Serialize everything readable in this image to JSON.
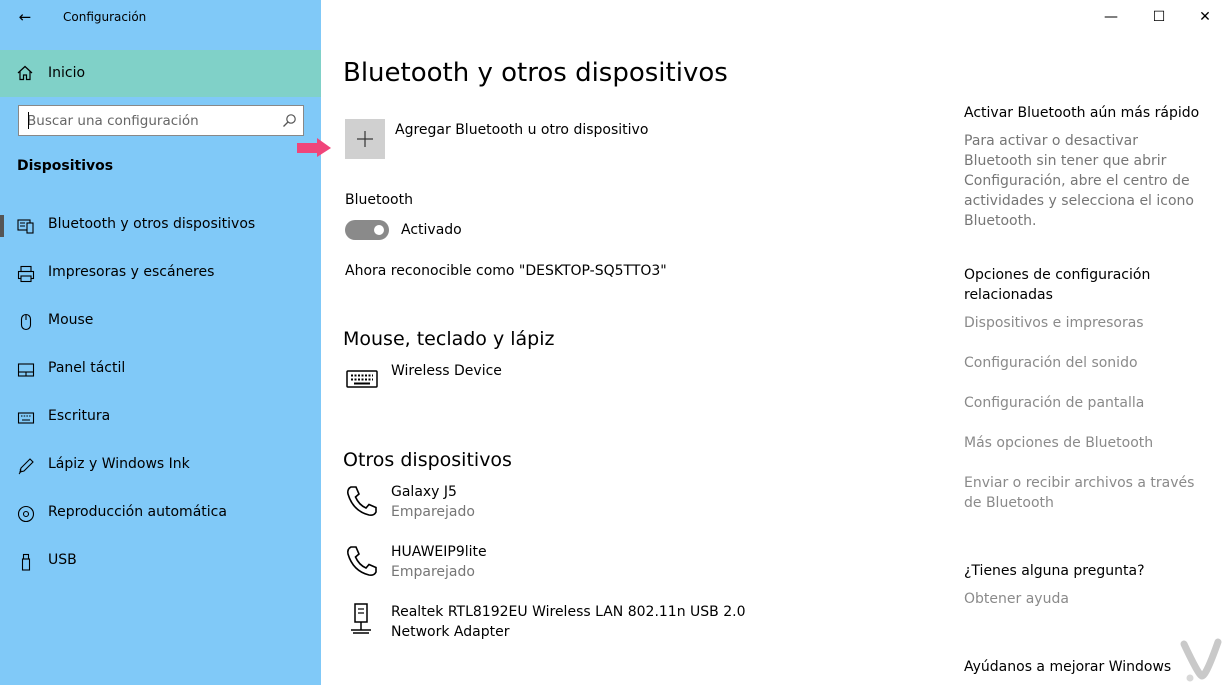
{
  "window": {
    "title": "Configuración",
    "minimize_glyph": "—",
    "maximize_glyph": "☐",
    "close_glyph": "✕"
  },
  "sidebar": {
    "back_glyph": "←",
    "home_label": "Inicio",
    "search_placeholder": "Buscar una configuración",
    "section_title": "Dispositivos",
    "items": [
      {
        "label": "Bluetooth y otros dispositivos",
        "icon": "bluetooth-devices-icon",
        "selected": true
      },
      {
        "label": "Impresoras y escáneres",
        "icon": "printer-icon",
        "selected": false
      },
      {
        "label": "Mouse",
        "icon": "mouse-icon",
        "selected": false
      },
      {
        "label": "Panel táctil",
        "icon": "touchpad-icon",
        "selected": false
      },
      {
        "label": "Escritura",
        "icon": "keyboard-icon",
        "selected": false
      },
      {
        "label": "Lápiz y Windows Ink",
        "icon": "pen-icon",
        "selected": false
      },
      {
        "label": "Reproducción automática",
        "icon": "autoplay-icon",
        "selected": false
      },
      {
        "label": "USB",
        "icon": "usb-icon",
        "selected": false
      }
    ]
  },
  "main": {
    "title": "Bluetooth y otros dispositivos",
    "add_device_label": "Agregar Bluetooth u otro dispositivo",
    "bluetooth_label": "Bluetooth",
    "bluetooth_state": "Activado",
    "discoverable_text": "Ahora reconocible como \"DESKTOP-SQ5TTO3\"",
    "mouse_section": {
      "title": "Mouse, teclado y lápiz",
      "devices": [
        {
          "name": "Wireless Device",
          "status": "",
          "icon": "keyboard-device-icon"
        }
      ]
    },
    "other_section": {
      "title": "Otros dispositivos",
      "devices": [
        {
          "name": "Galaxy J5",
          "status": "Emparejado",
          "icon": "phone-icon"
        },
        {
          "name": "HUAWEIP9lite",
          "status": "Emparejado",
          "icon": "phone-icon"
        },
        {
          "name": "Realtek RTL8192EU Wireless LAN 802.11n USB 2.0",
          "status": "Network Adapter",
          "icon": "network-adapter-icon"
        }
      ]
    }
  },
  "right": {
    "quick_title": "Activar Bluetooth aún más rápido",
    "quick_text": "Para activar o desactivar Bluetooth sin tener que abrir Configuración, abre el centro de actividades y selecciona el icono Bluetooth.",
    "related_title": "Opciones de configuración relacionadas",
    "related_links": [
      "Dispositivos e impresoras",
      "Configuración del sonido",
      "Configuración de pantalla",
      "Más opciones de Bluetooth",
      "Enviar o recibir archivos a través de Bluetooth"
    ],
    "question_title": "¿Tienes alguna pregunta?",
    "help_link": "Obtener ayuda",
    "improve_title": "Ayúdanos a mejorar Windows"
  },
  "colors": {
    "sidebar_bg": "#80c9f8",
    "home_highlight": "#80d1c8",
    "annotation_arrow": "#f0457a",
    "toggle_on": "#8a8a8a",
    "link_gray": "#8a8a8a"
  }
}
